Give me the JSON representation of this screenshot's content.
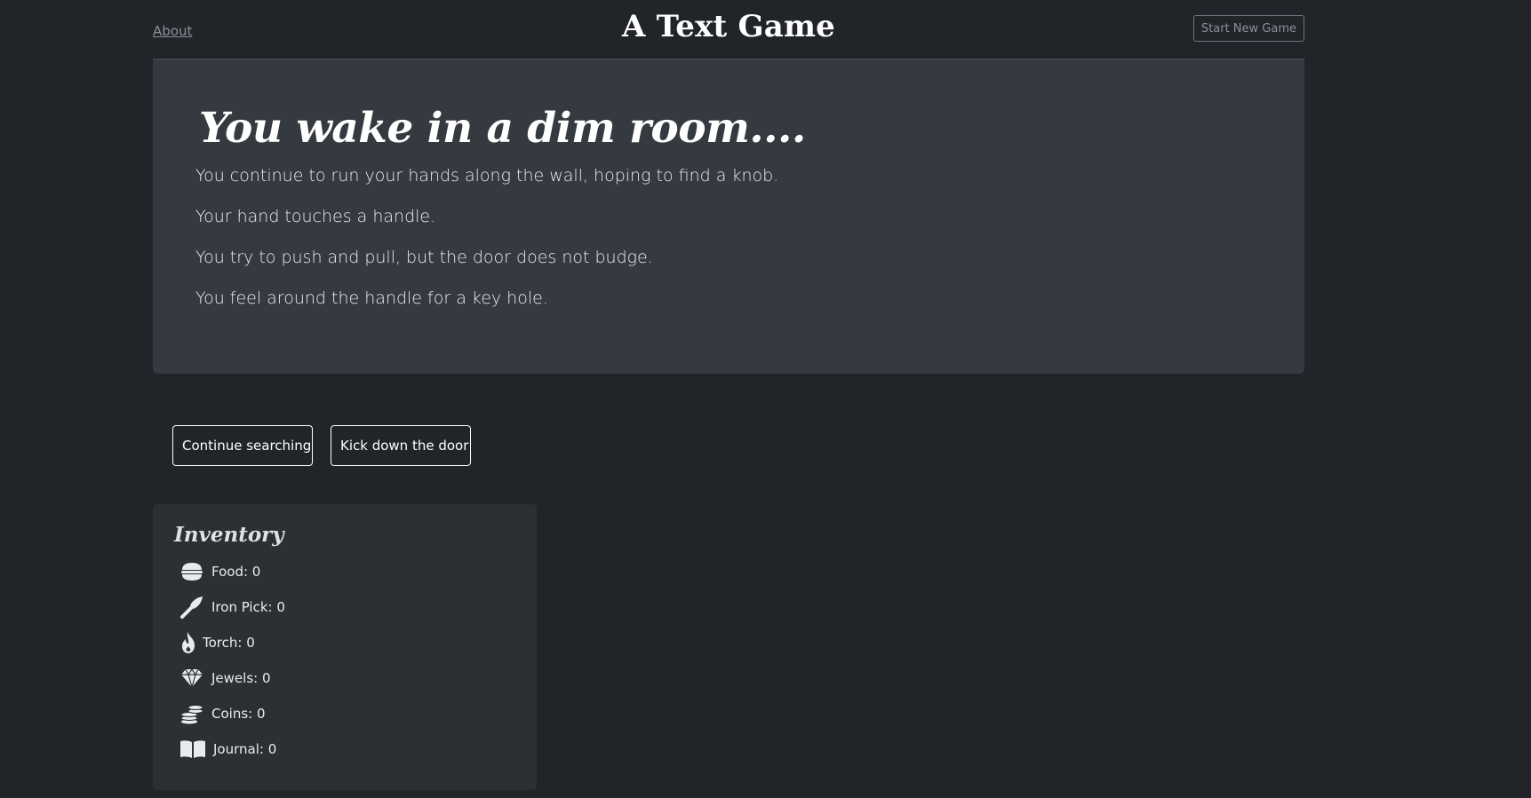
{
  "header": {
    "about_label": "About",
    "title": "A Text Game",
    "new_game_label": "Start New Game"
  },
  "story": {
    "heading": "You wake in a dim room....",
    "lines": [
      "You continue to run your hands along the wall, hoping to find a knob.",
      "Your hand touches a handle.",
      "You try to push and pull, but the door does not budge.",
      "You feel around the handle for a key hole."
    ]
  },
  "choices": [
    {
      "label": "Continue searching"
    },
    {
      "label": "Kick down the door"
    }
  ],
  "inventory": {
    "title": "Inventory",
    "items": [
      {
        "label": "Food: 0",
        "icon": "food-icon"
      },
      {
        "label": "Iron Pick: 0",
        "icon": "pick-icon"
      },
      {
        "label": "Torch: 0",
        "icon": "torch-icon"
      },
      {
        "label": "Jewels: 0",
        "icon": "jewel-icon"
      },
      {
        "label": "Coins: 0",
        "icon": "coins-icon"
      },
      {
        "label": "Journal: 0",
        "icon": "journal-icon"
      }
    ]
  },
  "colors": {
    "background": "#212529",
    "panel": "#343a40",
    "inventory_panel": "#2b3035",
    "text": "#e9ecef",
    "muted": "#8a9097"
  }
}
